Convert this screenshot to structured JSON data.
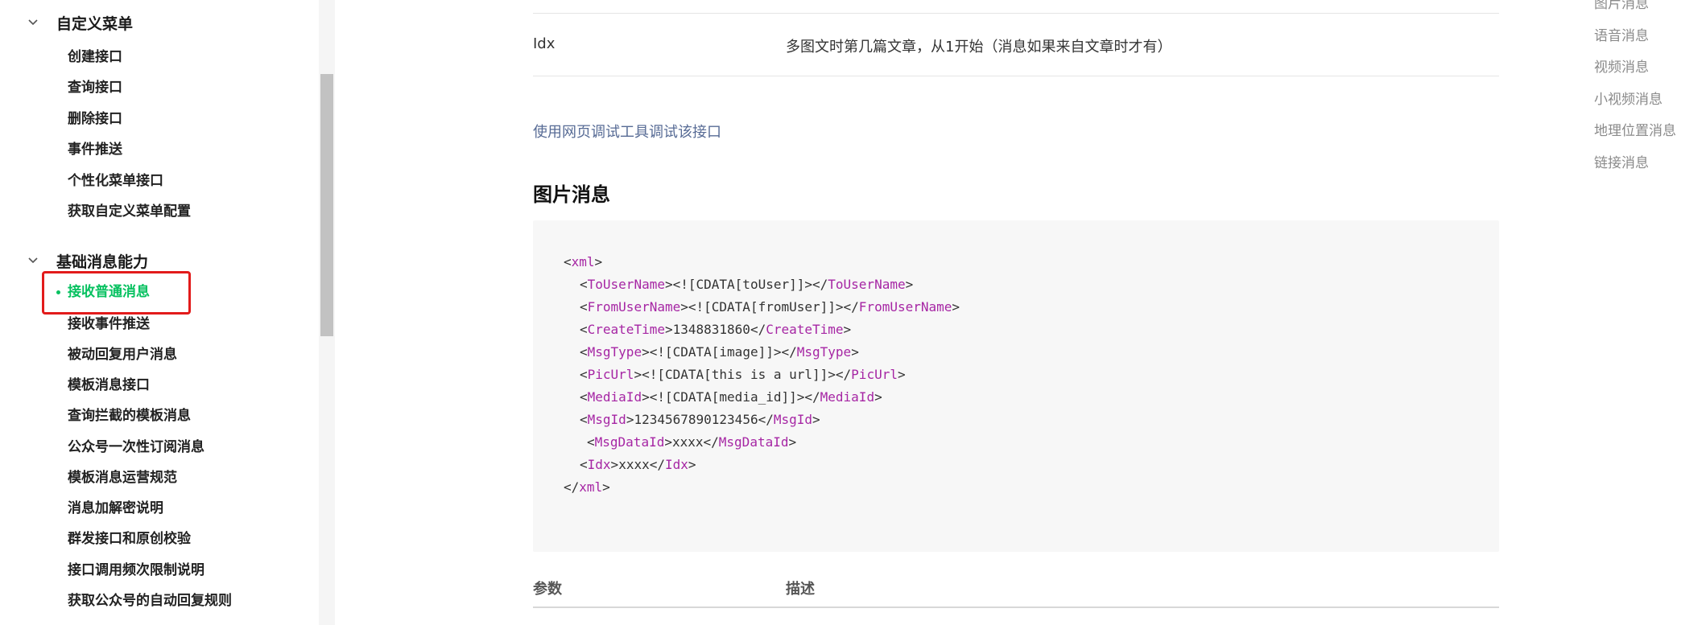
{
  "sidebar": {
    "groups": [
      {
        "title": "自定义菜单",
        "items": [
          "创建接口",
          "查询接口",
          "删除接口",
          "事件推送",
          "个性化菜单接口",
          "获取自定义菜单配置"
        ]
      },
      {
        "title": "基础消息能力",
        "items": [
          "接收普通消息",
          "接收事件推送",
          "被动回复用户消息",
          "模板消息接口",
          "查询拦截的模板消息",
          "公众号一次性订阅消息",
          "模板消息运营规范",
          "消息加解密说明",
          "群发接口和原创校验",
          "接口调用频次限制说明",
          "获取公众号的自动回复规则"
        ]
      }
    ],
    "active_item": "接收普通消息",
    "accent_color": "#07c160",
    "highlight_color": "#e21b1b"
  },
  "main": {
    "top_row": {
      "param": "Idx",
      "desc": "多图文时第几篇文章，从1开始（消息如果来自文章时才有）"
    },
    "debug_link": "使用网页调试工具调试该接口",
    "section_title": "图片消息",
    "code": {
      "xml_tag": "xml",
      "fields": [
        {
          "tag": "ToUserName",
          "value": "<![CDATA[toUser]]>"
        },
        {
          "tag": "FromUserName",
          "value": "<![CDATA[fromUser]]>"
        },
        {
          "tag": "CreateTime",
          "value": "1348831860"
        },
        {
          "tag": "MsgType",
          "value": "<![CDATA[image]]>"
        },
        {
          "tag": "PicUrl",
          "value": "<![CDATA[this is a url]]>"
        },
        {
          "tag": "MediaId",
          "value": "<![CDATA[media_id]]>"
        },
        {
          "tag": "MsgId",
          "value": "1234567890123456"
        },
        {
          "tag": "MsgDataId",
          "value": "xxxx"
        },
        {
          "tag": "Idx",
          "value": "xxxx"
        }
      ]
    },
    "table_header": {
      "param": "参数",
      "desc": "描述"
    },
    "link_color": "#576b95",
    "tag_color": "#a626a4"
  },
  "toc": {
    "items": [
      "图片消息",
      "语音消息",
      "视频消息",
      "小视频消息",
      "地理位置消息",
      "链接消息"
    ]
  }
}
